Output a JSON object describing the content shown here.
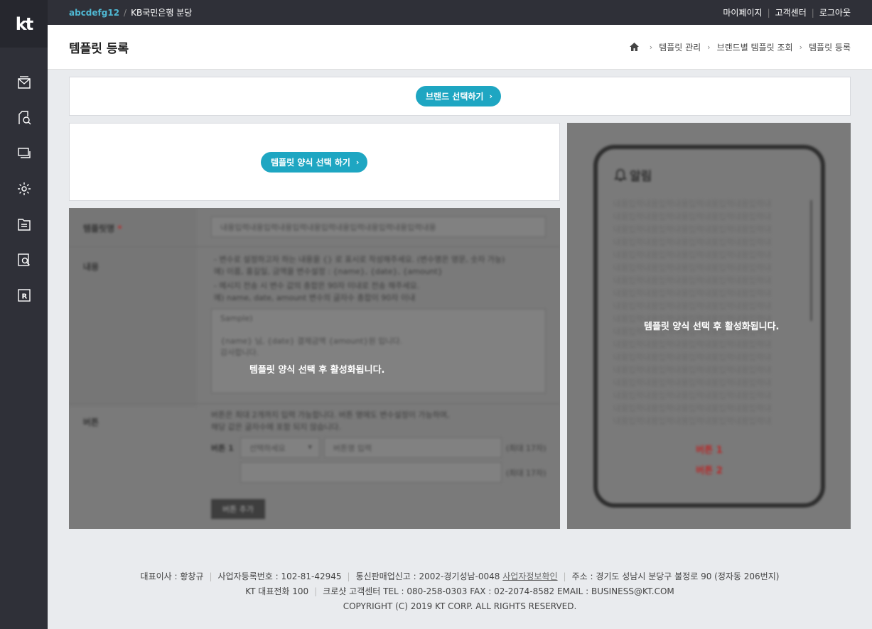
{
  "topbar": {
    "user": "abcdefg12",
    "separator": "/",
    "org": "KB국민은행 분당",
    "links": [
      "마이페이지",
      "고객센터",
      "로그아웃"
    ]
  },
  "sidebar": {
    "logo": "kt",
    "items": [
      {
        "icon": "message-icon"
      },
      {
        "icon": "search-document-icon"
      },
      {
        "icon": "chat-icon"
      },
      {
        "icon": "gear-icon"
      },
      {
        "icon": "folder-icon"
      },
      {
        "icon": "report-search-icon"
      },
      {
        "icon": "r-icon"
      }
    ]
  },
  "header": {
    "title": "템플릿 등록",
    "breadcrumb": [
      "템플릿 관리",
      "브랜드별 템플릿 조회",
      "템플릿 등록"
    ]
  },
  "brand_button": "브랜드 선택하기",
  "template_button": "템플릿 양식 선택 하기",
  "form": {
    "name_label": "템플릿명",
    "required_mark": "*",
    "name_value": "내용입력내용입력내용입력내용입력내용입력내용입력내용입력내용",
    "content_label": "내용",
    "content_help": [
      "- 변수로 설정하고자 하는 내용을 {} 로 표시로 작성해주세요. (변수명은 영문, 숫자 가능)",
      "  예) 이름, 홍길일, 금액을 변수설정 : {name}, {date}, {amount}",
      "- 메시지 전송 시 변수 값의 총합은 90자 이내로 전송 해주세요.",
      "  예) name, date, amount 변수의 글자수 총합이 90자 이내"
    ],
    "content_sample": [
      "Sample)",
      "",
      "{name} 님, {date} 결제금액 {amount}원 입니다.",
      "감사합니다."
    ],
    "button_label": "버튼",
    "button_help": [
      "버튼은 최대 2개까지 입력 가능합니다. 버튼 명에도 변수설정이 가능하며,",
      "해당 값은 글자수에 포함 되지 않습니다."
    ],
    "button1_label": "버튼 1",
    "select_placeholder": "선택하세요",
    "button_name_placeholder": "버튼명 입력",
    "max_chars": "(최대 17자)",
    "add_button": "버튼 추가",
    "overlay_message": "템플릿 양식 선택 후 활성화됩니다."
  },
  "preview": {
    "title": "알림",
    "body_line": "내용입력내용입력내용입력내용입력내용입력내",
    "line_count": 18,
    "button1": "버튼 1",
    "button2": "버튼 2",
    "overlay_message": "템플릿 양식 선택 후 활성화됩니다."
  },
  "footer": {
    "line1": [
      "대표이사 : 황창규",
      "사업자등록번호 : 102-81-42945",
      "통신판매업신고 : 2002-경기성남-0048",
      "사업자정보확인",
      "주소 : 경기도 성남시 분당구 불정로 90 (정자동 206번지)"
    ],
    "line2": [
      "KT 대표전화 100",
      "크로샷 고객센터 TEL : 080-258-0303 FAX : 02-2074-8582 EMAIL : BUSINESS@KT.COM"
    ],
    "line3": "COPYRIGHT (C) 2019 KT CORP. ALL RIGHTS RESERVED."
  },
  "colors": {
    "accent": "#1ea6c2",
    "sidebar": "#2f3038",
    "user": "#4fb8d3"
  }
}
